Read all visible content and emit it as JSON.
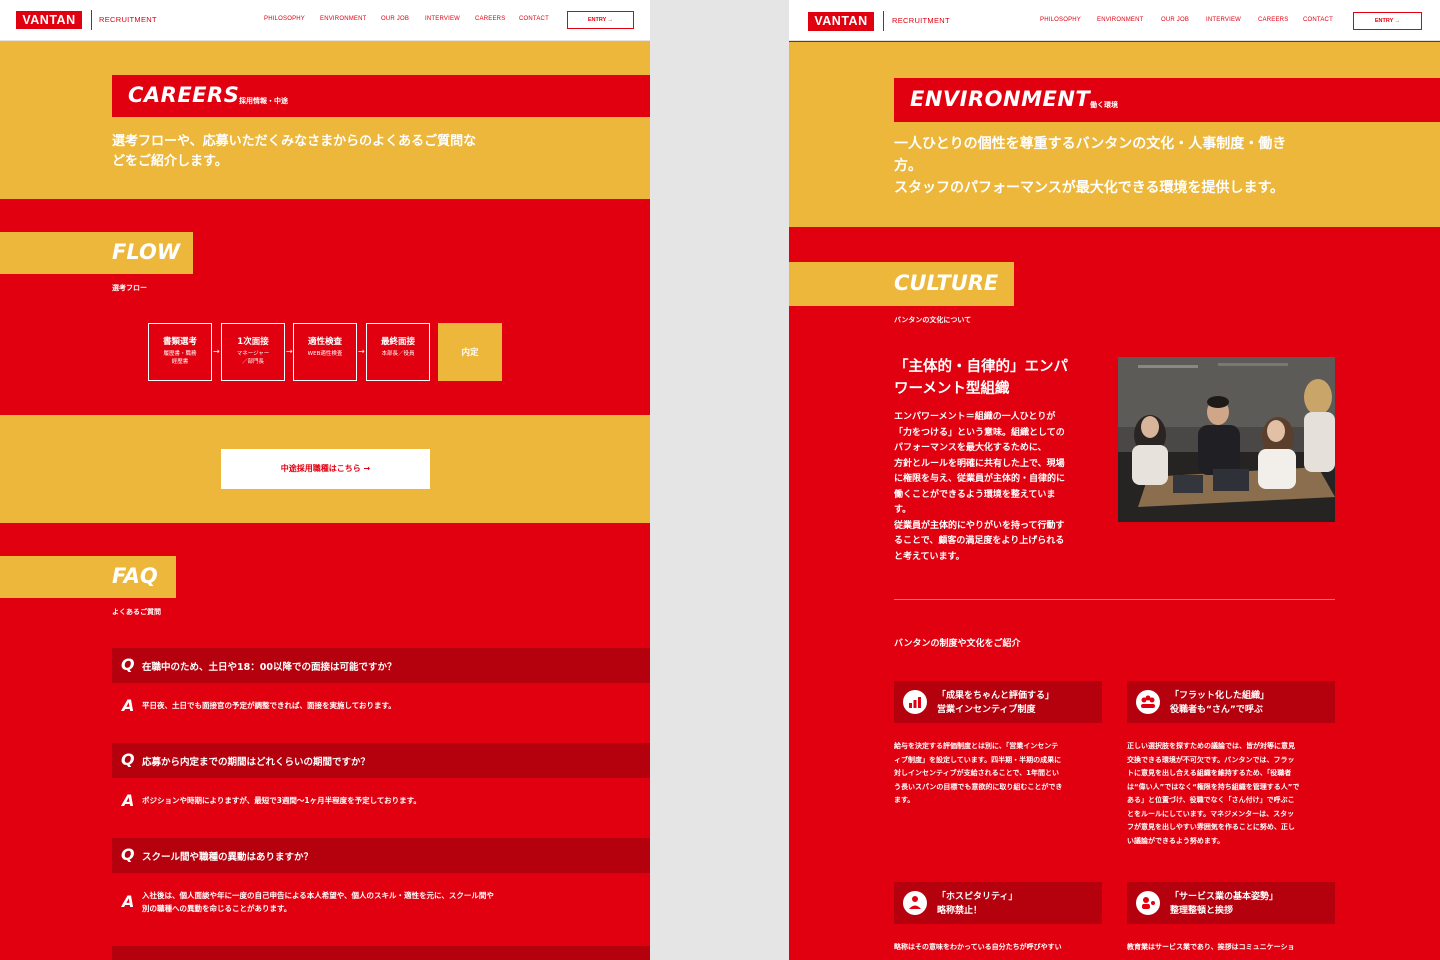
{
  "header": {
    "logo": "VANTAN",
    "sub": "RECRUITMENT",
    "nav": [
      "PHILOSOPHY",
      "ENVIRONMENT",
      "OUR JOB",
      "INTERVIEW",
      "CAREERS",
      "CONTACT"
    ],
    "entry": "ENTRY →"
  },
  "careers": {
    "title": "CAREERS",
    "sub": "採用情報・中途",
    "lead_1": "選考フローや、応募いただくみなさまからのよくあるご質問な",
    "lead_2": "どをご紹介します。",
    "flow": {
      "title": "FLOW",
      "sub": "選考フロー",
      "steps": [
        {
          "t": "書類選考",
          "d1": "履歴書・職務",
          "d2": "経歴書"
        },
        {
          "t": "1次面接",
          "d1": "マネージャー",
          "d2": "／部門長"
        },
        {
          "t": "適性検査",
          "d1": "WEB適性検査",
          "d2": ""
        },
        {
          "t": "最終面接",
          "d1": "本部長／役員",
          "d2": ""
        },
        {
          "t": "内定",
          "d1": "",
          "d2": ""
        }
      ]
    },
    "mid_button": "中途採用職種はこちら →",
    "faq": {
      "title": "FAQ",
      "sub": "よくあるご質問",
      "items": [
        {
          "q": "在職中のため、土日や18：00以降での面接は可能ですか？",
          "a1": "平日夜、土日でも面接官の予定が調整できれば、面接を実施しております。",
          "a2": ""
        },
        {
          "q": "応募から内定までの期間はどれくらいの期間ですか？",
          "a1": "ポジションや時期によりますが、最短で3週間〜1ヶ月半程度を予定しております。",
          "a2": ""
        },
        {
          "q": "スクール間や職種の異動はありますか？",
          "a1": "入社後は、個人面談や年に一度の自己申告による本人希望や、個人のスキル・適性を元に、スクール間や",
          "a2": "別の職種への異動を命じることがあります。"
        }
      ]
    }
  },
  "environment": {
    "title": "ENVIRONMENT",
    "sub": "働く環境",
    "lead_1": "一人ひとりの個性を尊重するバンタンの文化・人事制度・働き",
    "lead_2": "方。",
    "lead_3": "スタッフのパフォーマンスが最大化できる環境を提供します。",
    "culture": {
      "title": "CULTURE",
      "sub": "バンタンの文化について",
      "heading_1": "「主体的・自律的」エンパ",
      "heading_2": "ワーメント型組織",
      "body": [
        "エンパワーメント＝組織の一人ひとりが",
        "「力をつける」という意味。組織としての",
        "パフォーマンスを最大化するために、",
        "方針とルールを明確に共有した上で、現場",
        "に権限を与え、従業員が主体的・自律的に",
        "働くことができるよう環境を整えていま",
        "す。",
        "従業員が主体的にやりがいを持って行動す",
        "ることで、顧客の満足度をより上げられる",
        "と考えています。"
      ]
    },
    "intro": "バンタンの制度や文化をご紹介",
    "cards": [
      {
        "t1": "「成果をちゃんと評価する」",
        "t2": "営業インセンティブ制度",
        "icon": "chart-icon",
        "body": [
          "給与を決定する評価制度とは別に、「営業インセンテ",
          "ィブ制度」を設定しています。四半期・半期の成果に",
          "対しインセンティブが支給されることで、1年間とい",
          "う長いスパンの目標でも意欲的に取り組むことができ",
          "ます。"
        ]
      },
      {
        "t1": "「フラット化した組織」",
        "t2": "役職者も“さん”で呼ぶ",
        "icon": "people-icon",
        "body": [
          "正しい選択肢を探すための議論では、皆が対等に意見",
          "交換できる環境が不可欠です。バンタンでは、フラッ",
          "トに意見を出し合える組織を維持するため、「役職者",
          "は“偉い人”ではなく“権限を持ち組織を管理する人”で",
          "ある」と位置づけ、役職でなく「さん付け」で呼ぶこ",
          "とをルールにしています。マネジメンターは、スタッ",
          "フが意見を出しやすい雰囲気を作ることに努め、正し",
          "い議論ができるよう努めます。"
        ]
      },
      {
        "t1": "「ホスピタリティ」",
        "t2": "略称禁止！",
        "icon": "hospitality-icon",
        "body": [
          "略称はその意味をわかっている自分たちが呼びやすい"
        ]
      },
      {
        "t1": "「サービス業の基本姿勢」",
        "t2": "整理整頓と挨拶",
        "icon": "service-icon",
        "body": [
          "教育業はサービス業であり、挨拶はコミュニケーショ"
        ]
      }
    ]
  }
}
